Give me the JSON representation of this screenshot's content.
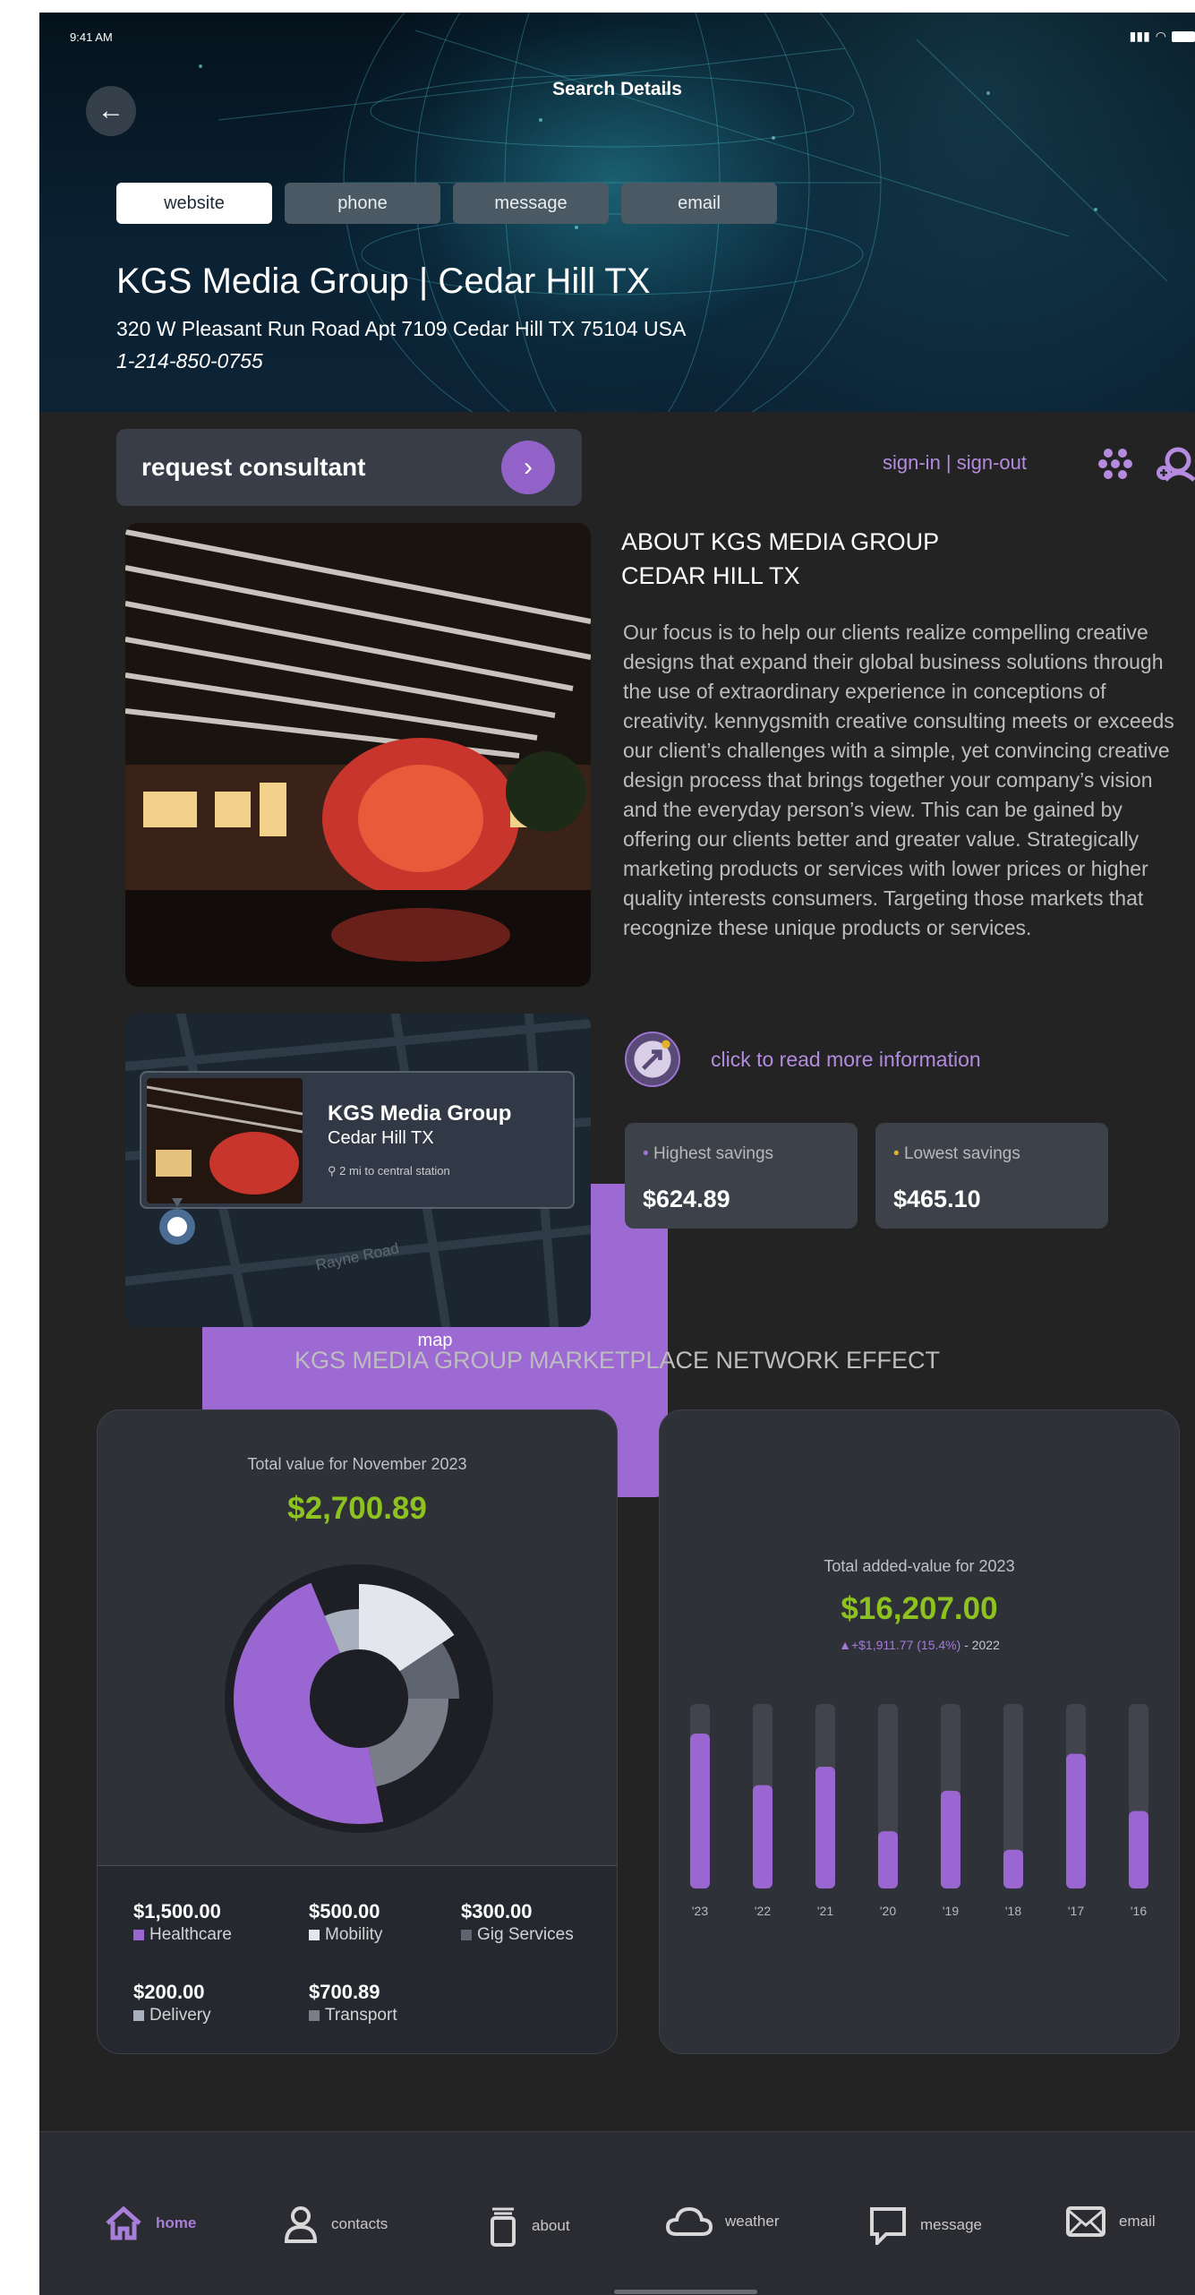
{
  "status": {
    "time": "9:41 AM"
  },
  "header": {
    "title": "Search Details"
  },
  "contact_tabs": [
    {
      "label": "website",
      "active": true
    },
    {
      "label": "phone"
    },
    {
      "label": "message"
    },
    {
      "label": "email"
    },
    {
      "label": "map"
    }
  ],
  "business": {
    "name": "KGS Media Group | Cedar Hill TX",
    "address": "320 W Pleasant Run Road Apt 7109 Cedar Hill TX 75104 USA",
    "phone": "1-214-850-0755"
  },
  "consult": {
    "label": "request consultant"
  },
  "auth": {
    "label": "sign-in | sign-out"
  },
  "about": {
    "title_line1": "ABOUT KGS MEDIA GROUP",
    "title_line2": "CEDAR HILL TX",
    "body": "Our focus is to help our clients realize compelling creative designs that expand their global business solutions through the use of extraordinary experience in conceptions of creativity. kennygsmith creative consulting meets or exceeds our client’s challenges with a simple, yet convincing creative design process that brings together your company’s vision and the everyday person’s view. This can be gained by offering our clients better and greater value. Strategically marketing products or services with lower prices or higher quality interests consumers. Targeting those markets that recognize these unique products or services.",
    "read_more": "click to read more information"
  },
  "savings": {
    "highest": {
      "label": "Highest savings",
      "value": "$624.89",
      "dot": "#9b72d6"
    },
    "lowest": {
      "label": "Lowest savings",
      "value": "$465.10",
      "dot": "#e3b22a"
    }
  },
  "map": {
    "name": "KGS Media Group",
    "city": "Cedar Hill TX",
    "distance": "2 mi to central station",
    "street": "Rayne Road"
  },
  "section_title": "KGS MEDIA GROUP MARKETPLACE NETWORK EFFECT",
  "chart_data": [
    {
      "type": "pie",
      "title": "Total value for November 2023",
      "total": "$2,700.89",
      "slices": [
        {
          "name": "Healthcare",
          "value": 1500.0,
          "label": "$1,500.00",
          "color": "#9a66d2"
        },
        {
          "name": "Mobility",
          "value": 500.0,
          "label": "$500.00",
          "color": "#e4e6ee"
        },
        {
          "name": "Gig Services",
          "value": 300.0,
          "label": "$300.00",
          "color": "#5f6471"
        },
        {
          "name": "Delivery",
          "value": 200.0,
          "label": "$200.00",
          "color": "#a9b0bd"
        },
        {
          "name": "Transport",
          "value": 700.89,
          "label": "$700.89",
          "color": "#797d88"
        }
      ]
    },
    {
      "type": "bar",
      "title": "Total added-value for 2023",
      "total": "$16,207.00",
      "delta": "+$1,911.77 (15.4%)",
      "delta_suffix": "- 2022",
      "categories": [
        "'23",
        "'22",
        "'21",
        "'20",
        "'19",
        "'18",
        "'17",
        "'16"
      ],
      "values": [
        0.84,
        0.56,
        0.66,
        0.31,
        0.53,
        0.21,
        0.73,
        0.42
      ],
      "ylim": [
        0,
        1
      ],
      "color": "#9a66d2"
    }
  ],
  "nav": [
    {
      "label": "home",
      "icon": "home-icon",
      "active": true
    },
    {
      "label": "contacts",
      "icon": "contact-icon"
    },
    {
      "label": "about",
      "icon": "about-icon"
    },
    {
      "label": "weather",
      "icon": "cloud-icon"
    },
    {
      "label": "message",
      "icon": "message-icon"
    },
    {
      "label": "email",
      "icon": "mail-icon"
    }
  ]
}
